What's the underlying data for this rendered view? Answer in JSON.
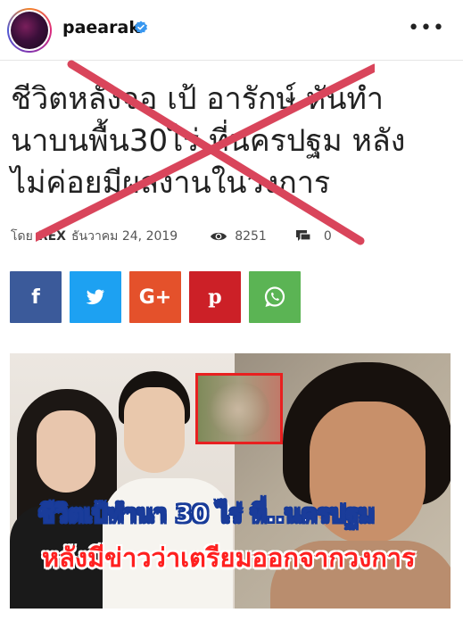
{
  "post": {
    "username": "paearak",
    "verified": true,
    "more_icon": "more-horizontal-icon"
  },
  "article": {
    "headline_lines": [
      "ชีวิตหลังจอ เป้ อารักษ์ หันทำ",
      "นาบนพื้น30ไร่ ที่นครปฐม หลัง",
      "ไม่ค่อยมีผลงานในวงการ"
    ],
    "by_label": "โดย",
    "author": "REX",
    "date": "ธันวาคม 24, 2019",
    "views": "8251",
    "comments": "0",
    "cross_color": "#d9455b"
  },
  "share": {
    "facebook": "f",
    "twitter": "twitter-bird-icon",
    "googleplus": "G+",
    "pinterest": "p",
    "whatsapp": "whatsapp-icon",
    "colors": {
      "facebook": "#3b5a9a",
      "twitter": "#1da1f2",
      "googleplus": "#e4512b",
      "pinterest": "#cc2027",
      "whatsapp": "#5bb454"
    }
  },
  "image": {
    "caption_line1": "ชีวิตเป้ทำนา 30 ไร่ ที่..นครปฐม",
    "caption_line2": "หลังมีข่าวว่าเตรียมออกจากวงการ"
  }
}
